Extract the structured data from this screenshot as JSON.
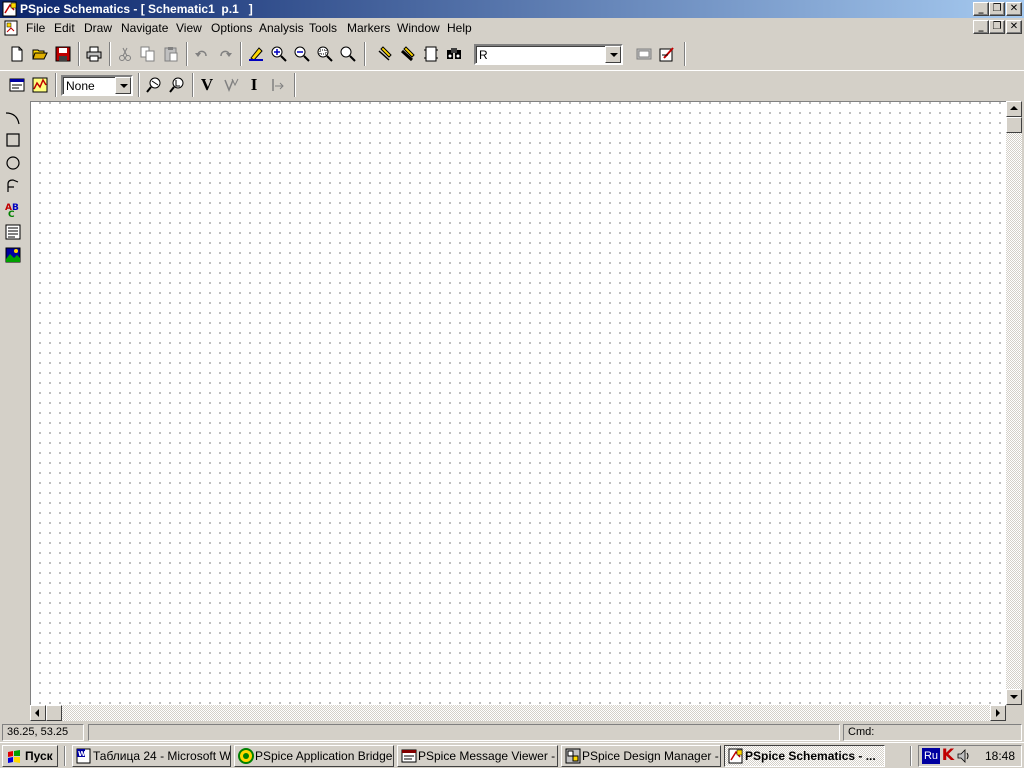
{
  "window": {
    "title": "PSpice Schematics - [ Schematic1  p.1   ]"
  },
  "menu": [
    "File",
    "Edit",
    "Draw",
    "Navigate",
    "View",
    "Options",
    "Analysis",
    "Tools",
    "Markers",
    "Window",
    "Help"
  ],
  "toolbar": {
    "part_combo_value": "R",
    "marker_combo_value": "None",
    "voltage_marker_label": "V",
    "current_marker_label": "I"
  },
  "status": {
    "coords": "36.25, 53.25",
    "cmd": "Cmd:"
  },
  "taskbar": {
    "start_label": "Пуск",
    "tasks": [
      "Таблица 24 - Microsoft W...",
      "PSpice Application Bridge",
      "PSpice Message Viewer - [...",
      "PSpice Design Manager - [...",
      "PSpice Schematics - ..."
    ],
    "active_task_index": 4,
    "tray_lang": "Ru",
    "tray_icon_letter": "K",
    "clock": "18:48"
  }
}
